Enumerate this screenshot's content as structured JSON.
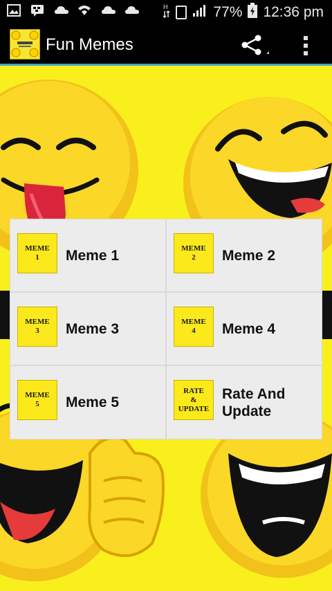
{
  "status_bar": {
    "battery": "77%",
    "time": "12:36 pm",
    "icons": [
      "image-icon",
      "bbm-icon",
      "cloud-icon",
      "wifi-icon",
      "cloud-icon",
      "cloud-icon",
      "network-icon",
      "sim-icon",
      "signal-icon",
      "battery-icon"
    ]
  },
  "app_bar": {
    "title": "Fun Memes",
    "share_icon": "share-icon",
    "menu_icon": "overflow-menu-icon"
  },
  "colors": {
    "background_yellow": "#f9ef1c",
    "app_bar": "#000000",
    "cell_bg": "#ececec",
    "tile_yellow": "#fbe91c",
    "accent_line": "#3aa7c8"
  },
  "grid": {
    "items": [
      {
        "tile_top": "MEME",
        "tile_mid": "",
        "tile_bottom": "1",
        "label": "Meme 1"
      },
      {
        "tile_top": "MEME",
        "tile_mid": "",
        "tile_bottom": "2",
        "label": "Meme 2"
      },
      {
        "tile_top": "MEME",
        "tile_mid": "",
        "tile_bottom": "3",
        "label": "Meme 3"
      },
      {
        "tile_top": "MEME",
        "tile_mid": "",
        "tile_bottom": "4",
        "label": "Meme 4"
      },
      {
        "tile_top": "MEME",
        "tile_mid": "",
        "tile_bottom": "5",
        "label": "Meme 5"
      },
      {
        "tile_top": "RATE",
        "tile_mid": "&",
        "tile_bottom": "UPDATE",
        "label": "Rate And Update"
      }
    ]
  }
}
